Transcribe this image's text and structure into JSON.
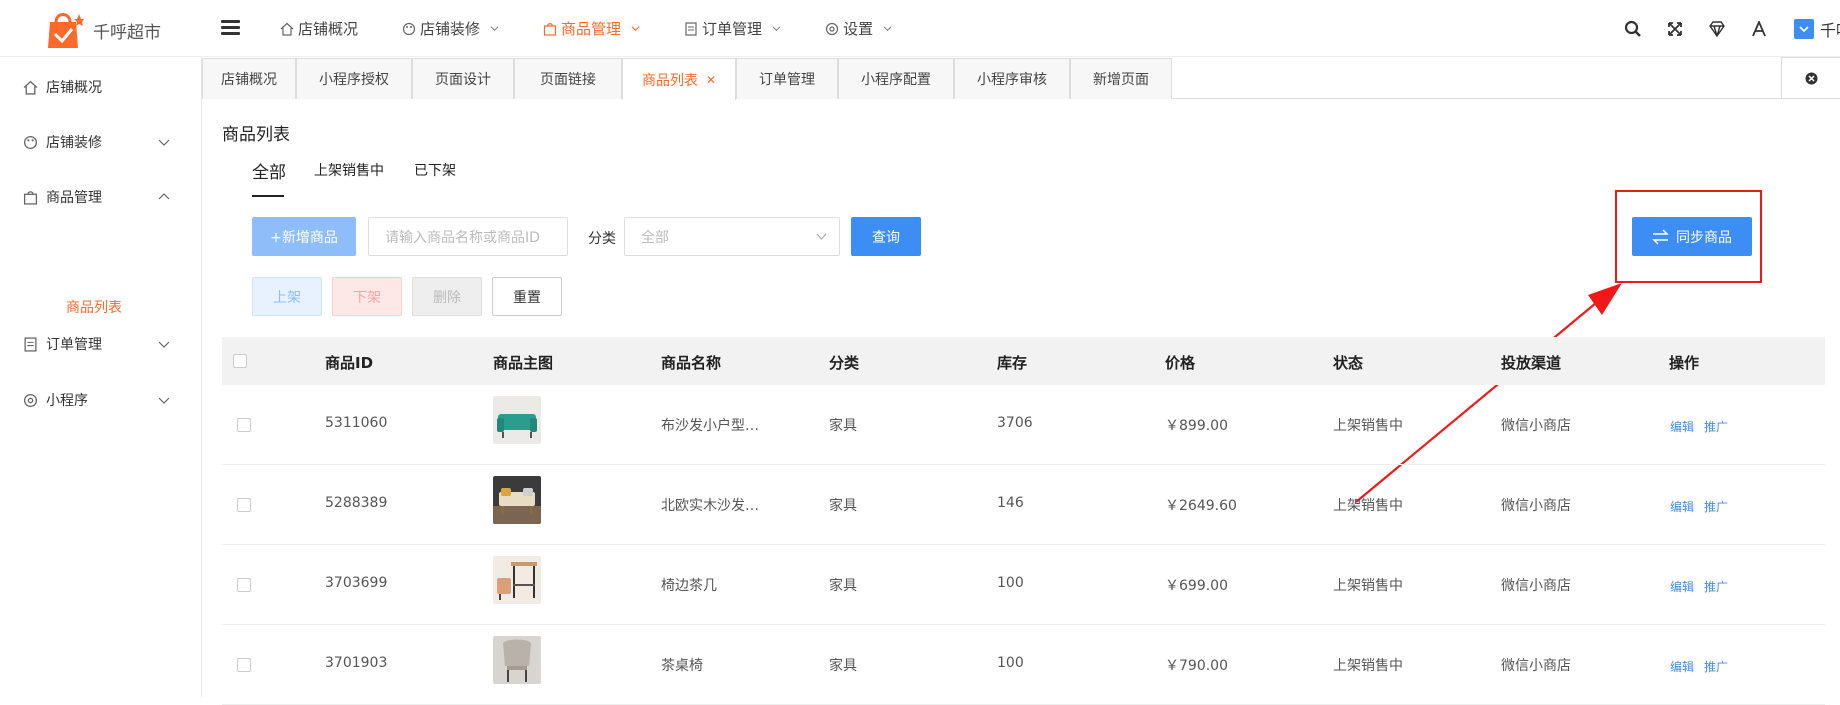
{
  "app": {
    "name": "千呼超市",
    "user_name": "千呼"
  },
  "topnav": [
    {
      "label": "店铺概况"
    },
    {
      "label": "店铺装修"
    },
    {
      "label": "商品管理"
    },
    {
      "label": "订单管理"
    },
    {
      "label": "设置"
    }
  ],
  "sidebar": {
    "items": [
      {
        "label": "店铺概况"
      },
      {
        "label": "店铺装修"
      },
      {
        "label": "商品管理"
      },
      {
        "label": "订单管理"
      },
      {
        "label": "小程序"
      }
    ],
    "sub_item": "商品列表"
  },
  "tabs": [
    "店铺概况",
    "小程序授权",
    "页面设计",
    "页面链接",
    "商品列表",
    "订单管理",
    "小程序配置",
    "小程序审核",
    "新增页面"
  ],
  "page": {
    "title": "商品列表",
    "subtabs": [
      "全部",
      "上架销售中",
      "已下架"
    ]
  },
  "toolbar": {
    "add_label": "+新增商品",
    "search_placeholder": "请输入商品名称或商品ID",
    "category_label": "分类",
    "category_value": "全部",
    "query_label": "查询",
    "sync_label": "同步商品",
    "up_label": "上架",
    "down_label": "下架",
    "delete_label": "删除",
    "reset_label": "重置"
  },
  "table": {
    "headers": [
      "商品ID",
      "商品主图",
      "商品名称",
      "分类",
      "库存",
      "价格",
      "状态",
      "投放渠道",
      "操作"
    ],
    "rows": [
      {
        "id": "5311060",
        "name": "布沙发小户型…",
        "category": "家具",
        "stock": "3706",
        "price": "￥899.00",
        "status": "上架销售中",
        "channel": "微信小商店",
        "edit": "编辑",
        "promote": "推广"
      },
      {
        "id": "5288389",
        "name": "北欧实木沙发…",
        "category": "家具",
        "stock": "146",
        "price": "￥2649.60",
        "status": "上架销售中",
        "channel": "微信小商店",
        "edit": "编辑",
        "promote": "推广"
      },
      {
        "id": "3703699",
        "name": "椅边茶几",
        "category": "家具",
        "stock": "100",
        "price": "￥699.00",
        "status": "上架销售中",
        "channel": "微信小商店",
        "edit": "编辑",
        "promote": "推广"
      },
      {
        "id": "3701903",
        "name": "茶桌椅",
        "category": "家具",
        "stock": "100",
        "price": "￥790.00",
        "status": "上架销售中",
        "channel": "微信小商店",
        "edit": "编辑",
        "promote": "推广"
      }
    ]
  },
  "colors": {
    "accent": "#ff6a2a",
    "primary": "#3c8ef5",
    "annotation": "#f01818"
  }
}
